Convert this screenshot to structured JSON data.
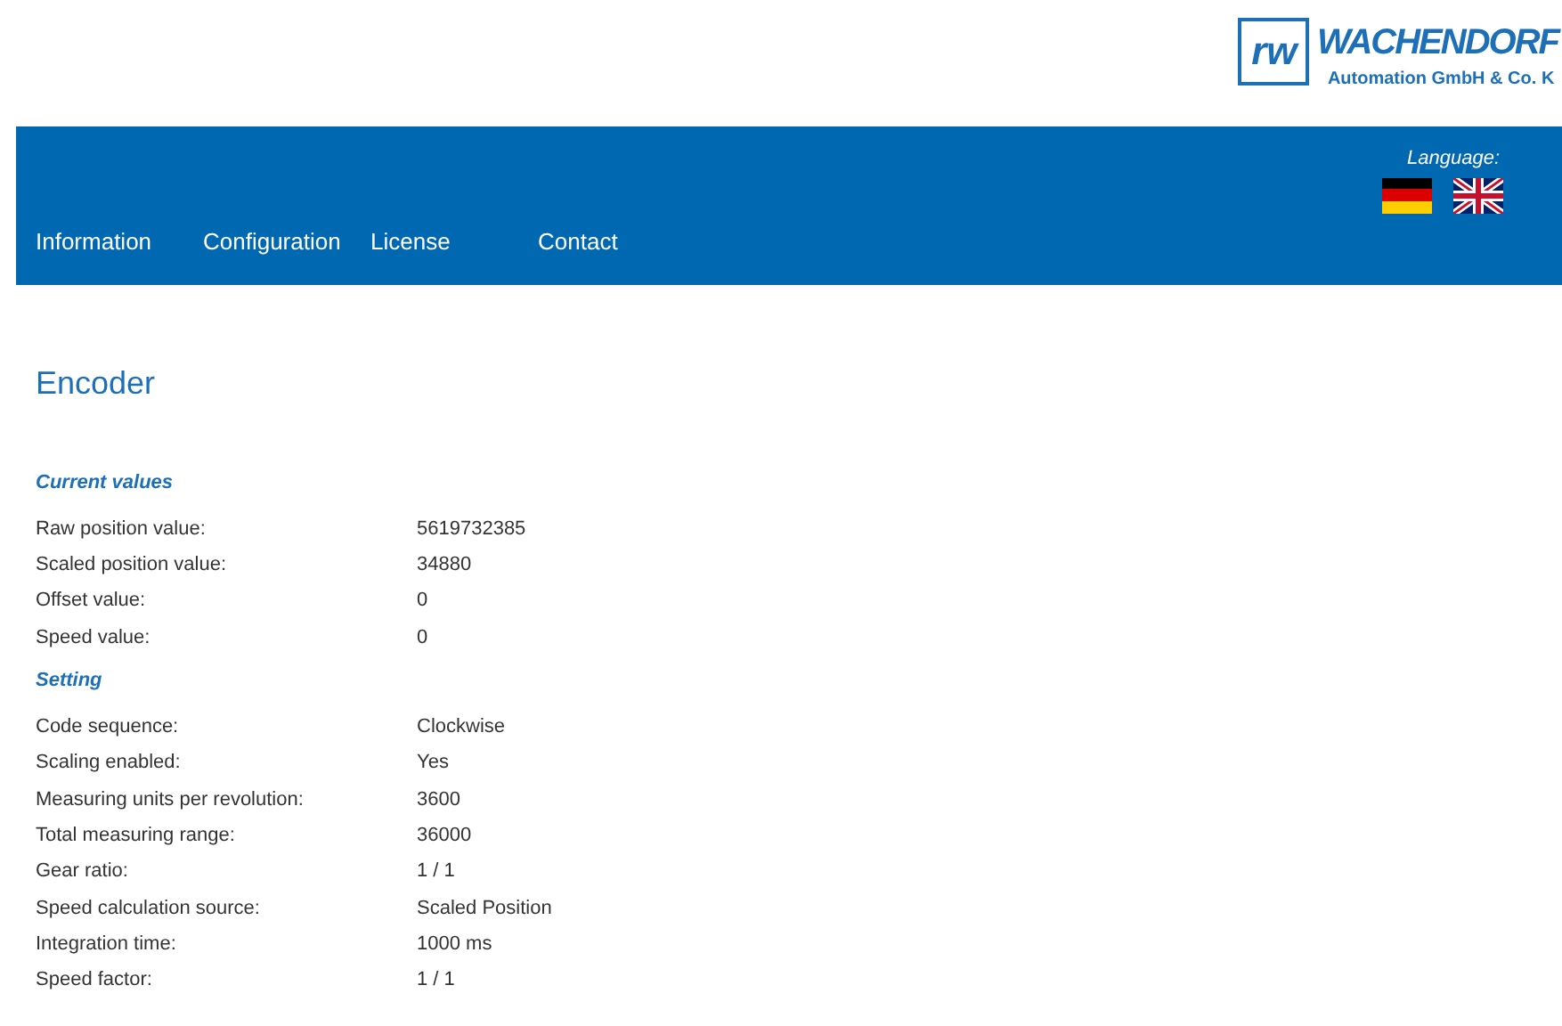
{
  "logo": {
    "mark": "rw",
    "name": "WACHENDORF",
    "subtitle": "Automation GmbH & Co. K"
  },
  "language": {
    "label": "Language:"
  },
  "nav": [
    {
      "label": "Information"
    },
    {
      "label": "Configuration"
    },
    {
      "label": "License"
    },
    {
      "label": "Contact"
    }
  ],
  "title": "Encoder",
  "sections": [
    {
      "heading": "Current values",
      "rows": [
        {
          "label": "Raw position value:",
          "value": "5619732385"
        },
        {
          "label": "Scaled position value:",
          "value": "34880"
        },
        {
          "label": "Offset value:",
          "value": "0"
        },
        {
          "label": "Speed value:",
          "value": "0"
        }
      ]
    },
    {
      "heading": "Setting",
      "rows": [
        {
          "label": "Code sequence:",
          "value": "Clockwise"
        },
        {
          "label": "Scaling enabled:",
          "value": "Yes"
        },
        {
          "label": "Measuring units per revolution:",
          "value": "3600"
        },
        {
          "label": "Total measuring range:",
          "value": "36000"
        },
        {
          "label": "Gear ratio:",
          "value": "1 / 1"
        },
        {
          "label": "Speed calculation source:",
          "value": "Scaled Position"
        },
        {
          "label": "Integration time:",
          "value": "1000 ms"
        },
        {
          "label": "Speed factor:",
          "value": "1 / 1"
        }
      ]
    }
  ]
}
